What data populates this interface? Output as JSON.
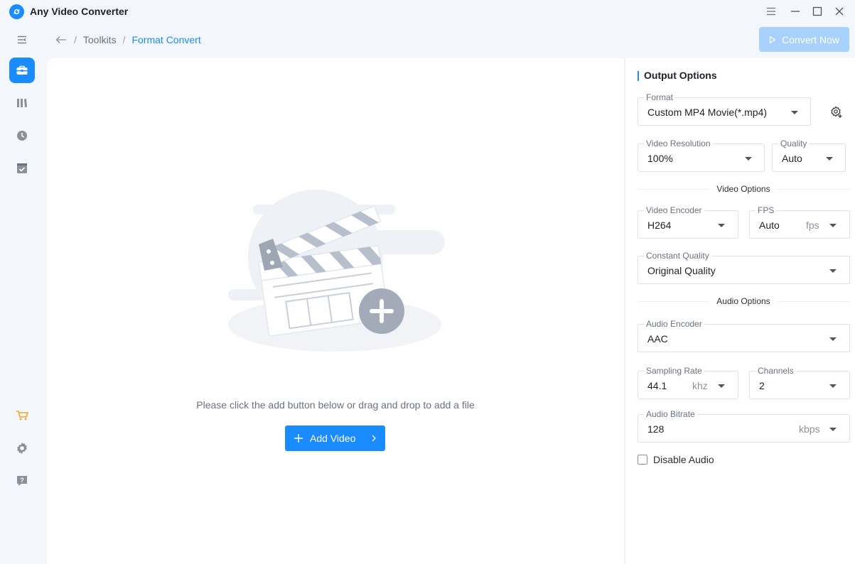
{
  "app": {
    "title": "Any Video Converter"
  },
  "breadcrumb": {
    "root": "Toolkits",
    "separator": "/",
    "current": "Format Convert"
  },
  "toolbar": {
    "convert_label": "Convert Now"
  },
  "main": {
    "hint": "Please click the add button below or drag and drop to add a file",
    "add_label": "Add Video"
  },
  "sidebar": {
    "items": [
      {
        "icon": "toolbox-icon",
        "active": true
      },
      {
        "icon": "library-icon",
        "active": false
      },
      {
        "icon": "history-icon",
        "active": false
      },
      {
        "icon": "task-icon",
        "active": false
      }
    ],
    "bottom": [
      "cart-icon",
      "settings-icon",
      "help-icon"
    ]
  },
  "output": {
    "title": "Output Options",
    "format": {
      "label": "Format",
      "value": "Custom MP4 Movie(*.mp4)"
    },
    "resolution": {
      "label": "Video Resolution",
      "value": "100%"
    },
    "quality": {
      "label": "Quality",
      "value": "Auto"
    },
    "video_section": "Video Options",
    "video_encoder": {
      "label": "Video Encoder",
      "value": "H264"
    },
    "fps": {
      "label": "FPS",
      "value": "Auto",
      "unit": "fps"
    },
    "constant_quality": {
      "label": "Constant Quality",
      "value": "Original Quality"
    },
    "audio_section": "Audio Options",
    "audio_encoder": {
      "label": "Audio Encoder",
      "value": "AAC"
    },
    "sampling_rate": {
      "label": "Sampling Rate",
      "value": "44.1",
      "unit": "khz"
    },
    "channels": {
      "label": "Channels",
      "value": "2"
    },
    "audio_bitrate": {
      "label": "Audio Bitrate",
      "value": "128",
      "unit": "kbps"
    },
    "disable_audio": {
      "label": "Disable Audio",
      "checked": false
    }
  },
  "colors": {
    "accent": "#1a8cff",
    "accent_disabled": "#a8d1fb",
    "background": "#f3f6fb"
  }
}
